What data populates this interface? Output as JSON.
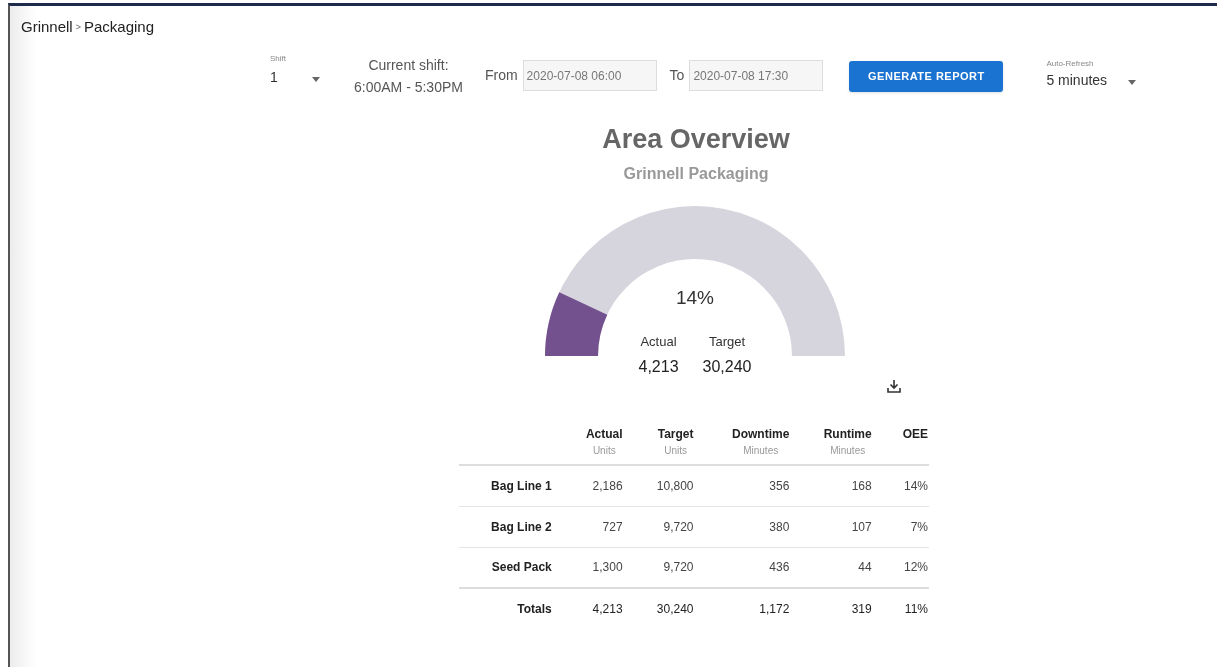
{
  "breadcrumb": {
    "parent": "Grinnell",
    "separator": ">",
    "current": "Packaging"
  },
  "controls": {
    "shift": {
      "label": "Shift",
      "value": "1"
    },
    "current_shift": {
      "label": "Current shift:",
      "value": "6:00AM - 5:30PM"
    },
    "from": {
      "label": "From",
      "value": "2020-07-08 06:00"
    },
    "to": {
      "label": "To",
      "value": "2020-07-08 17:30"
    },
    "generate_button": "GENERATE REPORT",
    "auto_refresh": {
      "label": "Auto-Refresh",
      "value": "5 minutes"
    }
  },
  "overview": {
    "title": "Area Overview",
    "subtitle": "Grinnell Packaging",
    "gauge": {
      "level": 0.14,
      "percent": "14%",
      "actual_label": "Actual",
      "actual": "4,213",
      "target_label": "Target",
      "target": "30,240"
    }
  },
  "table": {
    "columns": [
      {
        "title": "Actual",
        "unit": "Units"
      },
      {
        "title": "Target",
        "unit": "Units"
      },
      {
        "title": "Downtime",
        "unit": "Minutes"
      },
      {
        "title": "Runtime",
        "unit": "Minutes"
      },
      {
        "title": "OEE"
      }
    ],
    "rows": [
      {
        "label": "Bag Line 1",
        "cells": [
          "2,186",
          "10,800",
          "356",
          "168",
          "14%"
        ]
      },
      {
        "label": "Bag Line 2",
        "cells": [
          "727",
          "9,720",
          "380",
          "107",
          "7%"
        ]
      },
      {
        "label": "Seed Pack",
        "cells": [
          "1,300",
          "9,720",
          "436",
          "44",
          "12%"
        ]
      }
    ],
    "totals": {
      "label": "Totals",
      "cells": [
        "4,213",
        "30,240",
        "1,172",
        "319",
        "11%"
      ]
    }
  }
}
